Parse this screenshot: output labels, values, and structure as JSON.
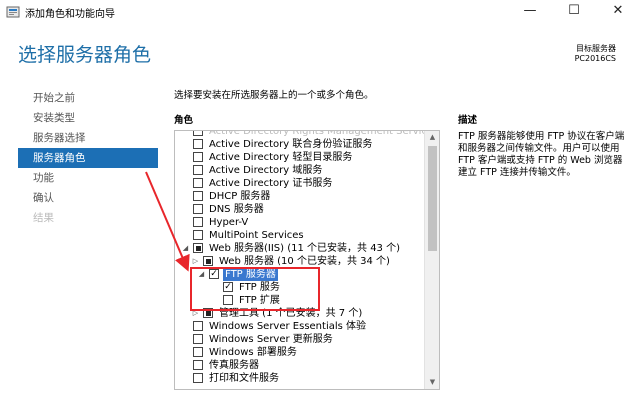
{
  "window": {
    "title": "添加角色和功能向导",
    "minimize": "—",
    "maximize": "☐",
    "close": "✕"
  },
  "page": {
    "title": "选择服务器角色",
    "destination_label": "目标服务器",
    "destination_server": "PC2016CS"
  },
  "nav": {
    "items": [
      {
        "label": "开始之前",
        "state": "normal"
      },
      {
        "label": "安装类型",
        "state": "normal"
      },
      {
        "label": "服务器选择",
        "state": "normal"
      },
      {
        "label": "服务器角色",
        "state": "selected"
      },
      {
        "label": "功能",
        "state": "normal"
      },
      {
        "label": "确认",
        "state": "normal"
      },
      {
        "label": "结果",
        "state": "disabled"
      }
    ]
  },
  "roles": {
    "instruction": "选择要安装在所选服务器上的一个或多个角色。",
    "column_header": "角色",
    "top_partial": "Active Directory Rights Management Services",
    "items": [
      {
        "label": "Active Directory 联合身份验证服务",
        "check": "none"
      },
      {
        "label": "Active Directory 轻型目录服务",
        "check": "none"
      },
      {
        "label": "Active Directory 域服务",
        "check": "none"
      },
      {
        "label": "Active Directory 证书服务",
        "check": "none"
      },
      {
        "label": "DHCP 服务器",
        "check": "none"
      },
      {
        "label": "DNS 服务器",
        "check": "none"
      },
      {
        "label": "Hyper-V",
        "check": "none"
      },
      {
        "label": "MultiPoint Services",
        "check": "none"
      },
      {
        "label": "Web 服务器(IIS) (11 个已安装，共 43 个)",
        "check": "partial"
      },
      {
        "label": "Web 服务器 (10 个已安装，共 34 个)",
        "check": "partial"
      },
      {
        "label": "FTP 服务器",
        "check": "checked"
      },
      {
        "label": "FTP 服务",
        "check": "checked"
      },
      {
        "label": "FTP 扩展",
        "check": "none"
      },
      {
        "label": "管理工具 (1 个已安装，共 7 个)",
        "check": "partial"
      },
      {
        "label": "Windows Server Essentials 体验",
        "check": "none"
      },
      {
        "label": "Windows Server 更新服务",
        "check": "none"
      },
      {
        "label": "Windows 部署服务",
        "check": "none"
      },
      {
        "label": "传真服务器",
        "check": "none"
      },
      {
        "label": "打印和文件服务",
        "check": "none"
      }
    ]
  },
  "description": {
    "header": "描述",
    "text": "FTP 服务器能够使用 FTP 协议在客户端和服务器之间传输文件。用户可以使用 FTP 客户端或支持 FTP 的 Web 浏览器建立 FTP 连接并传输文件。"
  },
  "colors": {
    "accent": "#1c6fb5",
    "title": "#1e6fa8",
    "highlight": "#3a78cf",
    "annotation": "#e8262b"
  }
}
